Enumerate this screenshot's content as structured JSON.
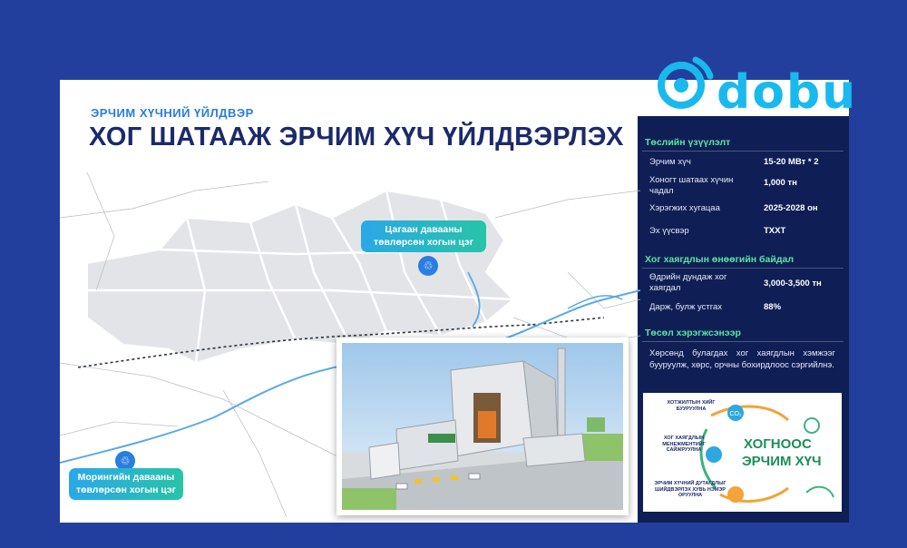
{
  "brand": {
    "logo_text": "dobu"
  },
  "header": {
    "kicker": "ЭРЧИМ ХҮЧНИЙ ҮЙЛДВЭР",
    "title": "ХОГ ШАТААЖ ЭРЧИМ ХҮЧ ҮЙЛДВЭРЛЭХ"
  },
  "map": {
    "callout_east": "Цагаан давааны төвлөрсөн хогын цэг",
    "callout_west": "Морингийн давааны төвлөрсөн хогын цэг",
    "pin_glyph": "♲"
  },
  "specs": {
    "heading": "Төслийн үзүүлэлт",
    "rows": [
      {
        "label": "Эрчим хүч",
        "value": "15-20 МВт * 2"
      },
      {
        "label": "Хоногт шатаах хүчин чадал",
        "value": "1,000 тн"
      },
      {
        "label": "Хэрэгжих хугацаа",
        "value": "2025-2028 он"
      },
      {
        "label": "Эх үүсвэр",
        "value": "ТХХТ"
      }
    ]
  },
  "waste": {
    "heading": "Хог хаягдлын өнөөгийн байдал",
    "rows": [
      {
        "label": "Өдрийн дундаж хог хаягдал",
        "value": "3,000-3,500 тн"
      },
      {
        "label": "Дарж, булж устгах",
        "value": "88%"
      }
    ]
  },
  "needs": {
    "heading": "Төсөл хэрэгжсэнээр",
    "text": "Хөрсөнд булагдах хог хаягдлын хэмжээг бууруулж, хөрс, орчны бохирдлоос сэргийлнэ."
  },
  "infographic": {
    "label_top": "ХОТЖИЛТЫН ХИЙГ БУУРУУЛНА",
    "label_mid": "ХОГ ХАЯГДЛЫН МЕНЕЖМЕНТИЙГ САЙЖРУУЛНА",
    "label_bot": "ЭРЧИМ ХҮЧНИЙ ДУТАГДЛЫГ ШИЙДВЭРЛЭХ ХУВЬ НЭМЭР ОРУУЛНА",
    "headline_1": "ХОГНООС",
    "headline_2": "ЭРЧИМ ХҮЧ"
  },
  "colors": {
    "background": "#233f9e",
    "panel": "#0f1f55",
    "accent_green": "#5ce3a4",
    "accent_blue": "#19b9ee",
    "title_navy": "#1b2a6b"
  }
}
